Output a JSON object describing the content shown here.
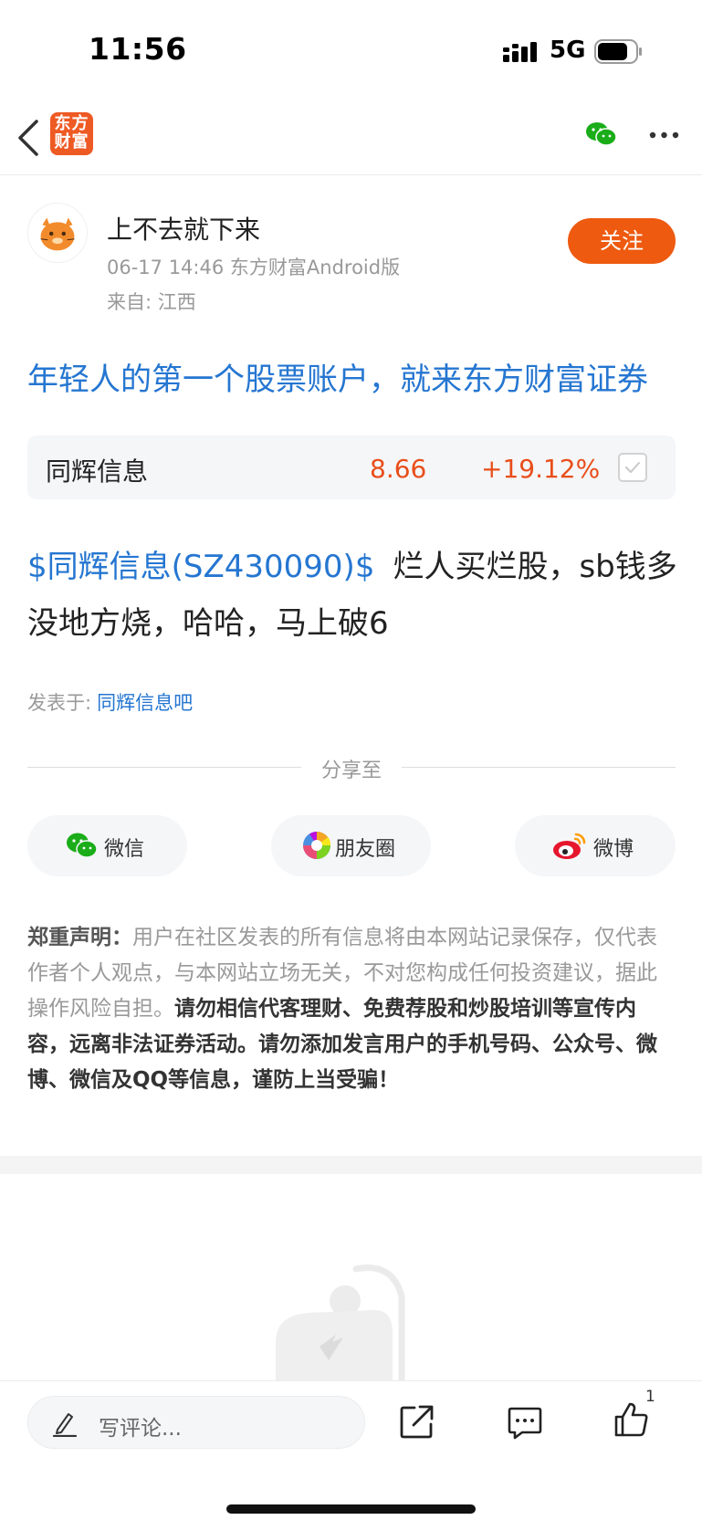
{
  "status": {
    "time": "11:56",
    "network": "5G"
  },
  "nav": {
    "logo_line1": "东方",
    "logo_line2": "财富"
  },
  "author": {
    "name": "上不去就下来",
    "meta": "06-17 14:46 东方财富Android版",
    "location": "来自: 江西",
    "follow_label": "关注"
  },
  "promo": "年轻人的第一个股票账户，就来东方财富证券",
  "stock": {
    "name": "同辉信息",
    "price": "8.66",
    "change": "+19.12%"
  },
  "post": {
    "tag": "$同辉信息(SZ430090)$",
    "text": "烂人买烂股，sb钱多没地方烧，哈哈，马上破6"
  },
  "posted_in": {
    "label": "发表于:",
    "bar": "同辉信息吧"
  },
  "share": {
    "title": "分享至",
    "wechat": "微信",
    "moments": "朋友圈",
    "weibo": "微博"
  },
  "disclaimer": {
    "title": "郑重声明：",
    "normal": "用户在社区发表的所有信息将由本网站记录保存，仅代表作者个人观点，与本网站立场无关，不对您构成任何投资建议，据此操作风险自担。",
    "bold": "请勿相信代客理财、免费荐股和炒股培训等宣传内容，远离非法证券活动。请勿添加发言用户的手机号码、公众号、微博、微信及QQ等信息，谨防上当受骗！"
  },
  "bottom": {
    "comment_placeholder": "写评论...",
    "like_count": "1"
  },
  "colors": {
    "accent": "#ee5a0f",
    "link": "#2576d1",
    "price": "#e94e1b",
    "wechat": "#1aad19"
  }
}
